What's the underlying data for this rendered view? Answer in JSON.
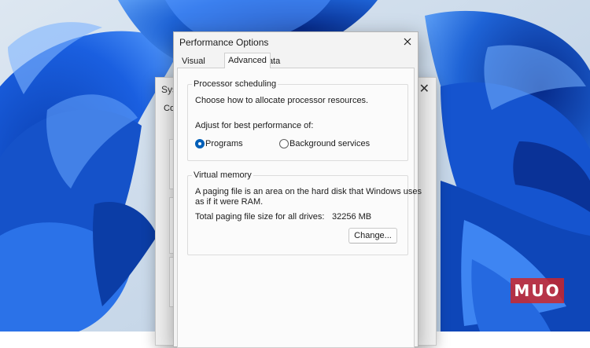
{
  "background_window": {
    "title_fragment": "Syst",
    "tab_fragment": "Co"
  },
  "dialog": {
    "title": "Performance Options",
    "close_icon": "close-icon",
    "tabs": [
      {
        "label": "Visual Effects",
        "active": false
      },
      {
        "label": "Advanced",
        "active": true
      },
      {
        "label": "Data Execution Prevention",
        "active": false
      }
    ],
    "processor_scheduling": {
      "heading": "Processor scheduling",
      "description": "Choose how to allocate processor resources.",
      "adjust_label": "Adjust for best performance of:",
      "options": [
        {
          "label": "Programs",
          "selected": true
        },
        {
          "label": "Background services",
          "selected": false
        }
      ]
    },
    "virtual_memory": {
      "heading": "Virtual memory",
      "description_line1": "A paging file is an area on the hard disk that Windows uses",
      "description_line2": "as if it were RAM.",
      "total_label": "Total paging file size for all drives:",
      "total_value": "32256 MB",
      "change_button": "Change..."
    }
  },
  "watermark": {
    "text": "MUO"
  },
  "colors": {
    "accent": "#005fb8",
    "wallpaper_light": "#cddcec",
    "wallpaper_blue": "#1e63d6",
    "watermark": "#d22323"
  }
}
